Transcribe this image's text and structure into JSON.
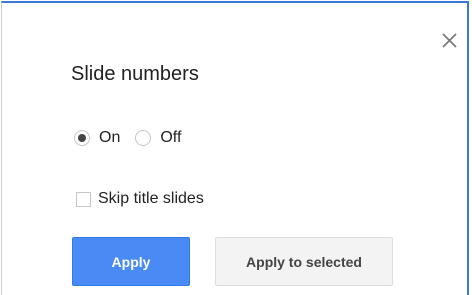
{
  "dialog": {
    "title": "Slide numbers",
    "close_icon": "close-icon",
    "options": {
      "on_label": "On",
      "off_label": "Off",
      "selected": "On"
    },
    "skip_title": {
      "label": "Skip title slides",
      "checked": false
    },
    "buttons": {
      "apply_label": "Apply",
      "apply_selected_label": "Apply to selected"
    }
  },
  "colors": {
    "primary_button": "#4a8af4",
    "secondary_button": "#f3f3f3",
    "focus_border": "#3c78d8"
  }
}
